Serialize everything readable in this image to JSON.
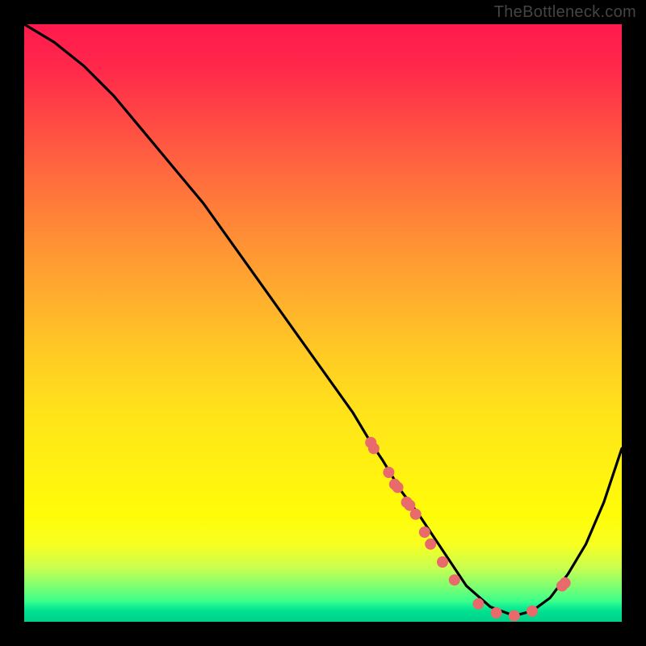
{
  "watermark": "TheBottleneck.com",
  "chart_data": {
    "type": "line",
    "title": "",
    "xlabel": "",
    "ylabel": "",
    "xlim": [
      0,
      100
    ],
    "ylim": [
      0,
      100
    ],
    "curve": {
      "x": [
        0,
        5,
        10,
        15,
        20,
        25,
        30,
        35,
        40,
        45,
        50,
        55,
        58,
        60,
        63,
        66,
        70,
        74,
        78,
        82,
        85,
        88,
        91,
        94,
        97,
        100
      ],
      "y": [
        100,
        97,
        93,
        88,
        82,
        76,
        70,
        63,
        56,
        49,
        42,
        35,
        30,
        27,
        22,
        18,
        12,
        6,
        2.5,
        1,
        1.8,
        4,
        8,
        13,
        20,
        29
      ]
    },
    "dots": {
      "x": [
        58,
        58.5,
        61,
        62,
        62.5,
        64,
        64.5,
        65.5,
        67,
        68,
        70,
        72,
        76,
        79,
        82,
        85,
        90,
        90.5
      ],
      "y": [
        30,
        29,
        25,
        23,
        22.5,
        20,
        19.5,
        18,
        15,
        13,
        10,
        7,
        3,
        1.5,
        1,
        1.8,
        6,
        6.5
      ]
    },
    "gradient_stops": [
      {
        "pct": 0,
        "color": "#ff1a4d"
      },
      {
        "pct": 50,
        "color": "#ffca24"
      },
      {
        "pct": 85,
        "color": "#fffc08"
      },
      {
        "pct": 100,
        "color": "#00ffa0"
      }
    ]
  }
}
